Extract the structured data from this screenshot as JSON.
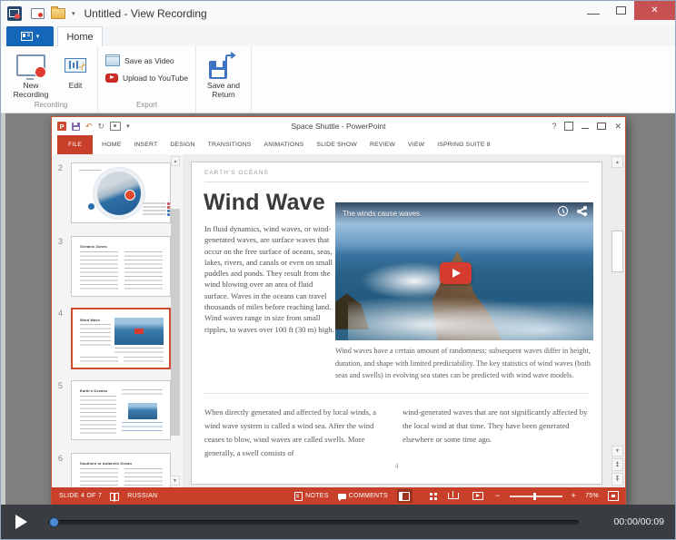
{
  "recorder": {
    "window_title": "Untitled - View Recording",
    "home_tab": "Home",
    "groups": {
      "recording": "Recording",
      "export": "Export"
    },
    "buttons": {
      "new_recording": "New Recording",
      "edit": "Edit",
      "save_as_video": "Save as Video",
      "upload_to_youtube": "Upload to YouTube",
      "save_and_return": "Save and Return"
    }
  },
  "powerpoint": {
    "window_title": "Space Shuttle - PowerPoint",
    "tabs": [
      "FILE",
      "HOME",
      "INSERT",
      "DESIGN",
      "TRANSITIONS",
      "ANIMATIONS",
      "SLIDE SHOW",
      "REVIEW",
      "VIEW",
      "ISPRING SUITE 8"
    ],
    "thumbnails": [
      {
        "number": "2",
        "title": ""
      },
      {
        "number": "3",
        "title": "Oceanic Zones"
      },
      {
        "number": "4",
        "title": "Wind Wave",
        "selected": true
      },
      {
        "number": "5",
        "title": "Earth's Oceans"
      },
      {
        "number": "6",
        "title": "Southern or Antarctic Ocean"
      }
    ],
    "slide": {
      "eyebrow": "EARTH'S OCEANS",
      "title": "Wind Wave",
      "intro": "In fluid dynamics, wind waves, or wind-generated waves, are surface waves that occur on the free surface of oceans, seas, lakes, rivers, and canals or even on small puddles and ponds. They result from the wind blowing over an area of fluid surface. Waves in the oceans can travel thousands of miles before reaching land. Wind waves range in size from small ripples, to waves over 100 ft (30 m) high.",
      "video_overlay_title": "The winds cause waves",
      "video_caption": "Wind waves have a certain amount of randomness: subsequent waves differ in height, duration, and shape with limited predictability. The key statistics of wind waves (both seas and swells) in evolving sea states can be predicted with wind wave models.",
      "column_left": "When directly generated and affected by local winds, a wind wave system is called a wind sea. After the wind ceases to blow, wind waves are called swells. More generally, a swell consists of",
      "column_right": "wind-generated waves that are not significantly affected by the local wind at that time. They have been generated elsewhere or some time ago.",
      "page_number": "4"
    },
    "status": {
      "slide_indicator": "SLIDE 4 OF 7",
      "language": "RUSSIAN",
      "notes": "NOTES",
      "comments": "COMMENTS",
      "zoom_level": "75%"
    }
  },
  "player": {
    "time": "00:00/00:09"
  },
  "glyphs": {
    "close": "✕",
    "help": "?",
    "undo": "↶",
    "redo": "↻",
    "caret": "▾",
    "scissors": "✂",
    "minus": "−",
    "plus": "+",
    "up_arrow": "▲",
    "down_arrow": "▼",
    "logo_letter": "P"
  },
  "colors": {
    "accent_red": "#c8402a",
    "app_blue": "#1467b8",
    "workspace_gray": "#7f7f7f",
    "player_bg": "#393d42",
    "close_red": "#c75050",
    "progress_thumb_blue": "#4b8bd5"
  }
}
